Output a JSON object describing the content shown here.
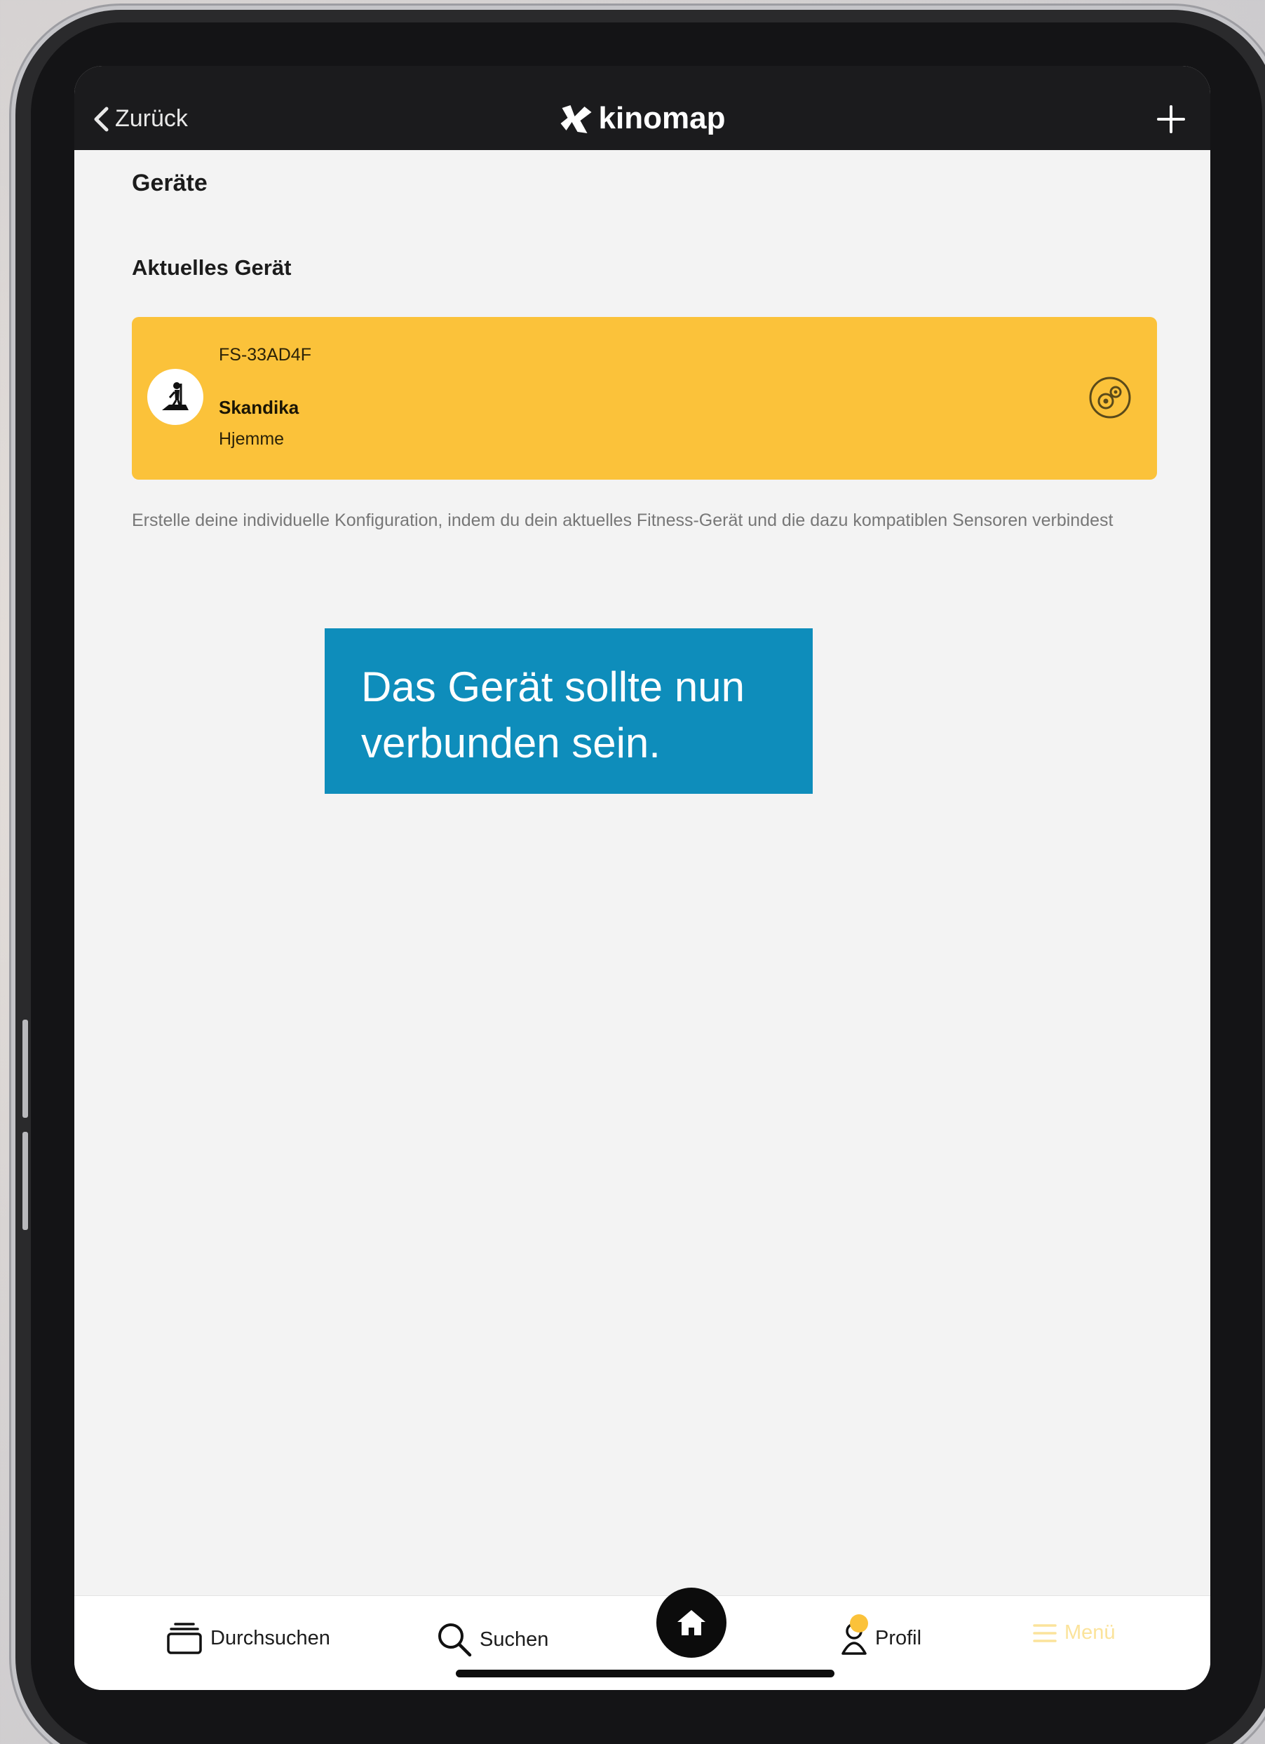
{
  "header": {
    "back_label": "Zurück",
    "logo_text": "kinomap"
  },
  "page": {
    "title": "Geräte",
    "current_device_heading": "Aktuelles Gerät",
    "helper_text": "Erstelle deine individuelle Konfiguration, indem du dein aktuelles Fitness-Gerät und die dazu kompatiblen Sensoren verbindest"
  },
  "device": {
    "id": "FS-33AD4F",
    "brand": "Skandika",
    "location": "Hjemme"
  },
  "callout": {
    "text": "Das Gerät sollte nun verbunden sein."
  },
  "tabbar": {
    "browse_label": "Durchsuchen",
    "search_label": "Suchen",
    "profile_label": "Profil",
    "menu_label": "Menü"
  },
  "colors": {
    "accent_yellow": "#fbc23a",
    "callout_blue": "#0e8dbb",
    "header_dark": "#1b1b1d",
    "screen_background": "#f3f3f3"
  }
}
